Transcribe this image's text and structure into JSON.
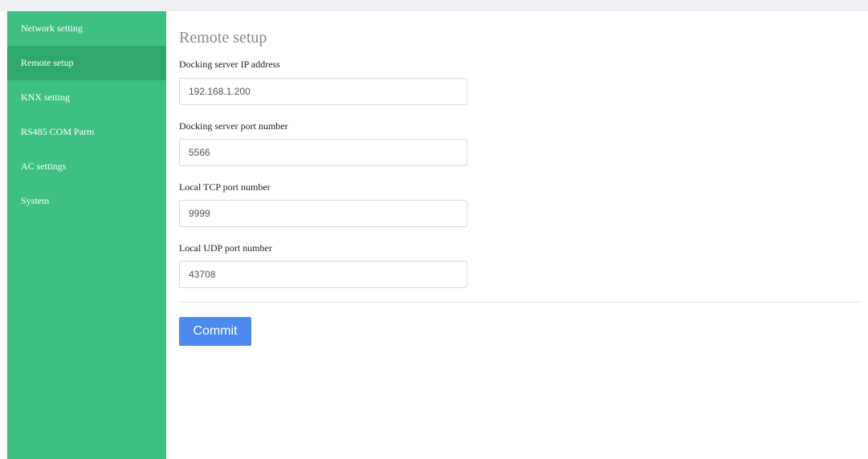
{
  "sidebar": {
    "items": [
      {
        "label": "Network setting"
      },
      {
        "label": "Remote setup"
      },
      {
        "label": "KNX setting"
      },
      {
        "label": "RS485 COM Parm"
      },
      {
        "label": "AC settings"
      },
      {
        "label": "System"
      }
    ],
    "active_item": "Remote setup"
  },
  "main": {
    "title": "Remote setup",
    "fields": [
      {
        "label": "Docking server IP address",
        "value": "192.168.1.200"
      },
      {
        "label": "Docking server port number",
        "value": "5566"
      },
      {
        "label": "Local TCP port number",
        "value": "9999"
      },
      {
        "label": "Local UDP port number",
        "value": "43708"
      }
    ],
    "commit_label": "Commit"
  },
  "colors": {
    "sidebar_bg": "#3ec083",
    "sidebar_active_bg": "#2ea86d",
    "button_bg": "#4d8af0",
    "title_text": "#8a8a8a"
  }
}
